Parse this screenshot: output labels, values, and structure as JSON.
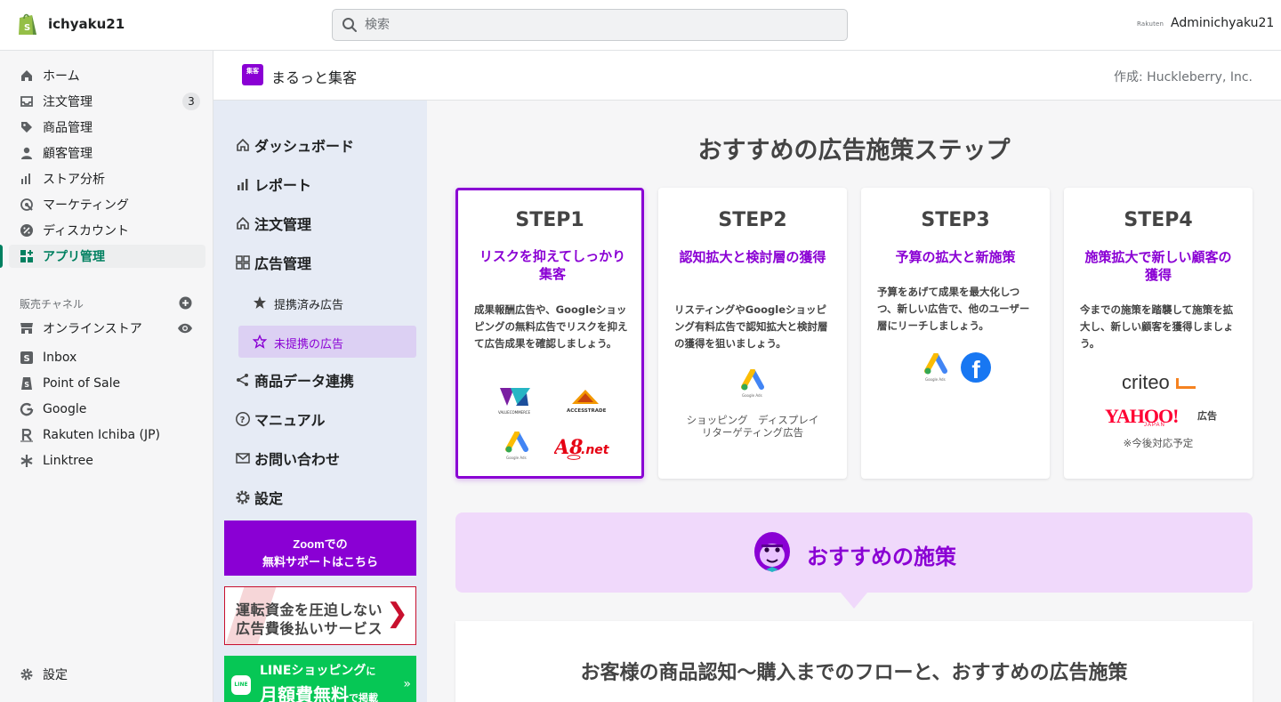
{
  "topbar": {
    "store_name": "ichyaku21",
    "search_placeholder": "検索",
    "admin_logo_text": "Rakuten",
    "admin_name": "Adminichyaku21"
  },
  "nav": {
    "items": [
      {
        "label": "ホーム",
        "icon": "home-icon"
      },
      {
        "label": "注文管理",
        "icon": "inbox-icon",
        "badge": "3"
      },
      {
        "label": "商品管理",
        "icon": "tag-icon"
      },
      {
        "label": "顧客管理",
        "icon": "person-icon"
      },
      {
        "label": "ストア分析",
        "icon": "bar-chart-icon"
      },
      {
        "label": "マーケティング",
        "icon": "target-icon"
      },
      {
        "label": "ディスカウント",
        "icon": "discount-icon"
      },
      {
        "label": "アプリ管理",
        "icon": "apps-icon",
        "active": true
      }
    ],
    "sales_heading": "販売チャネル",
    "channels": [
      {
        "label": "オンラインストア",
        "icon": "store-icon"
      },
      {
        "label": "Inbox",
        "icon": "inbox-app-icon"
      },
      {
        "label": "Point of Sale",
        "icon": "pos-icon"
      },
      {
        "label": "Google",
        "icon": "google-icon"
      },
      {
        "label": "Rakuten Ichiba (JP)",
        "icon": "rakuten-icon"
      },
      {
        "label": "Linktree",
        "icon": "linktree-icon"
      }
    ],
    "settings_label": "設定"
  },
  "app": {
    "logo_text": "集客",
    "title": "まるっと集客",
    "author": "作成: Huckleberry, Inc."
  },
  "app_menu": {
    "items": [
      {
        "label": "ダッシュボード",
        "icon": "home-outline-icon"
      },
      {
        "label": "レポート",
        "icon": "report-bars-icon"
      },
      {
        "label": "注文管理",
        "icon": "home-outline-icon"
      },
      {
        "label": "広告管理",
        "icon": "grid-icon"
      }
    ],
    "sub_items": [
      {
        "label": "提携済み広告",
        "icon": "star-filled-icon"
      },
      {
        "label": "未提携の広告",
        "icon": "star-outline-icon",
        "active": true
      }
    ],
    "items2": [
      {
        "label": "商品データ連携",
        "icon": "share-icon"
      },
      {
        "label": "マニュアル",
        "icon": "help-icon"
      },
      {
        "label": "お問い合わせ",
        "icon": "mail-icon"
      },
      {
        "label": "設定",
        "icon": "gear-icon"
      }
    ],
    "zoom_line1": "Zoomでの",
    "zoom_line2": "無料サポートはこちら",
    "banner1_line1": "運転資金を圧迫しない",
    "banner1_line2": "広告費後払いサービス",
    "banner2_line1": "LINEショッピング",
    "banner2_line1_suffix": "に",
    "banner2_line2": "月額費無料",
    "banner2_line2_suffix": "で掲載",
    "banner2_icon_text": "LINE"
  },
  "main": {
    "title": "おすすめの広告施策ステップ",
    "steps": [
      {
        "title": "STEP1",
        "subtitle": "リスクを抑えてしっかり集客",
        "desc": "成果報酬広告や、Googleショッピングの無料広告でリスクを抑えて広告成果を確認しましょう。",
        "logos": [
          "VALUECOMMERCE",
          "ACCESSTRADE",
          "Google Ads",
          "A8.net"
        ]
      },
      {
        "title": "STEP2",
        "subtitle": "認知拡大と検討層の獲得",
        "desc": "リスティングやGoogleショッピング有料広告で認知拡大と検討層の獲得を狙いましょう。",
        "logos": [
          "Google Ads"
        ],
        "note": "ショッピング　ディスプレイ\nリターゲティング広告"
      },
      {
        "title": "STEP3",
        "subtitle": "予算の拡大と新施策",
        "desc": "予算をあげて成果を最大化しつつ、新しい広告で、他のユーザー層にリーチしましょう。",
        "logos": [
          "Google Ads",
          "Facebook"
        ]
      },
      {
        "title": "STEP4",
        "subtitle": "施策拡大で新しい顧客の獲得",
        "desc": "今までの施策を踏襲して施策を拡大し、新しい顧客を獲得しましょう。",
        "logos": [
          "criteo",
          "YAHOO! JAPAN 広告"
        ],
        "note": "※今後対応予定"
      }
    ],
    "logo_texts": {
      "valuecommerce": "VALUECOMMERCE",
      "accesstrade": "ACCESSTRADE",
      "google_ads_caption": "Google Ads",
      "a8": "A8.net",
      "facebook": "f",
      "criteo": "criteo",
      "yahoo": "YAHOO!",
      "yahoo_japan": "JAPAN",
      "yahoo_ad": "広告"
    },
    "reco_label": "おすすめの施策",
    "flow_title": "お客様の商品認知〜購入までのフローと、おすすめの広告施策"
  },
  "colors": {
    "accent_purple": "#8a00d4",
    "shopify_green": "#008060",
    "reco_band": "#f0d9fb",
    "app_sidebar": "#e6ebf5"
  }
}
